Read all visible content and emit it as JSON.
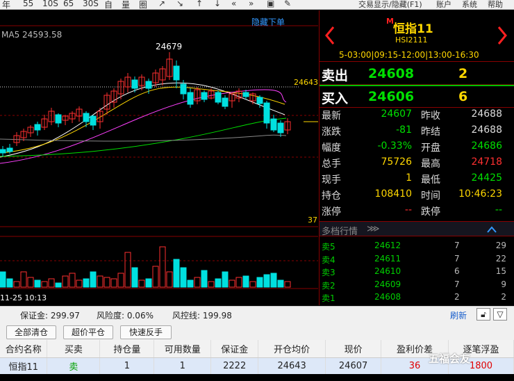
{
  "toolbar": {
    "icons": [
      "年",
      "55",
      "10S",
      "65",
      "30S",
      "自",
      "量",
      "圈",
      "↗",
      "↘",
      "↑",
      "↓",
      "«",
      "»",
      "▣",
      "✎"
    ],
    "menu": [
      "交易显示/隐藏(F1)",
      "账户",
      "系统",
      "帮助"
    ]
  },
  "chart": {
    "ma_label": "MA5 24593.58",
    "hide_label": "隐藏下单",
    "peak_label": "24679",
    "ref_label": "24643",
    "vol_scale_label": "37",
    "time_label": "11-25 10:13"
  },
  "quote": {
    "name": "恒指11",
    "m_tag": "M",
    "code": "HSI2111",
    "session": "5-03:00|09:15-12:00|13:00-16:30",
    "sell_label": "卖出",
    "sell_price": "24608",
    "sell_qty": "2",
    "buy_label": "买入",
    "buy_price": "24606",
    "buy_qty": "6",
    "stats": [
      {
        "k1": "最新",
        "v1": "24607",
        "c1": "#00e000",
        "k2": "昨收",
        "v2": "24688",
        "c2": "#ddd"
      },
      {
        "k1": "涨跌",
        "v1": "-81",
        "c1": "#00e000",
        "k2": "昨结",
        "v2": "24688",
        "c2": "#ddd"
      },
      {
        "k1": "幅度",
        "v1": "-0.33%",
        "c1": "#00e000",
        "k2": "开盘",
        "v2": "24686",
        "c2": "#00e000"
      },
      {
        "k1": "总手",
        "v1": "75726",
        "c1": "#ffd700",
        "k2": "最高",
        "v2": "24718",
        "c2": "#ff3030"
      },
      {
        "k1": "现手",
        "v1": "1",
        "c1": "#ffd700",
        "k2": "最低",
        "v2": "24425",
        "c2": "#00e000"
      },
      {
        "k1": "持仓",
        "v1": "108410",
        "c1": "#ffd700",
        "k2": "时间",
        "v2": "10:46:23",
        "c2": "#ffd700"
      },
      {
        "k1": "涨停",
        "v1": "--",
        "c1": "#ff3030",
        "k2": "跌停",
        "v2": "--",
        "c2": "#00e000"
      }
    ],
    "depth_title": "多档行情",
    "depth": [
      {
        "k": "卖5",
        "p": "24612",
        "a": "7",
        "b": "29"
      },
      {
        "k": "卖4",
        "p": "24611",
        "a": "7",
        "b": "22"
      },
      {
        "k": "卖3",
        "p": "24610",
        "a": "6",
        "b": "15"
      },
      {
        "k": "卖2",
        "p": "24609",
        "a": "7",
        "b": "9"
      },
      {
        "k": "卖1",
        "p": "24608",
        "a": "2",
        "b": "2"
      }
    ]
  },
  "status": {
    "margin_label": "保证金: 299.97",
    "risk_label": "风险度: 0.06%",
    "control_label": "风控线: 199.98",
    "refresh": "刷新"
  },
  "buttons": {
    "close_all": "全部清仓",
    "flat": "超价平仓",
    "reverse": "快速反手"
  },
  "table": {
    "headers": [
      "合约名称",
      "买卖",
      "持仓量",
      "可用数量",
      "保证金",
      "开仓均价",
      "现价",
      "盈利价差",
      "逐笔浮盈"
    ],
    "row": [
      "恒指11",
      "卖",
      "1",
      "1",
      "2222",
      "24643",
      "24607",
      "36",
      "1800"
    ]
  },
  "watermark": "五福会友",
  "colors": {
    "up": "#ff3030",
    "down": "#00e0e0",
    "grid": "#800000"
  }
}
